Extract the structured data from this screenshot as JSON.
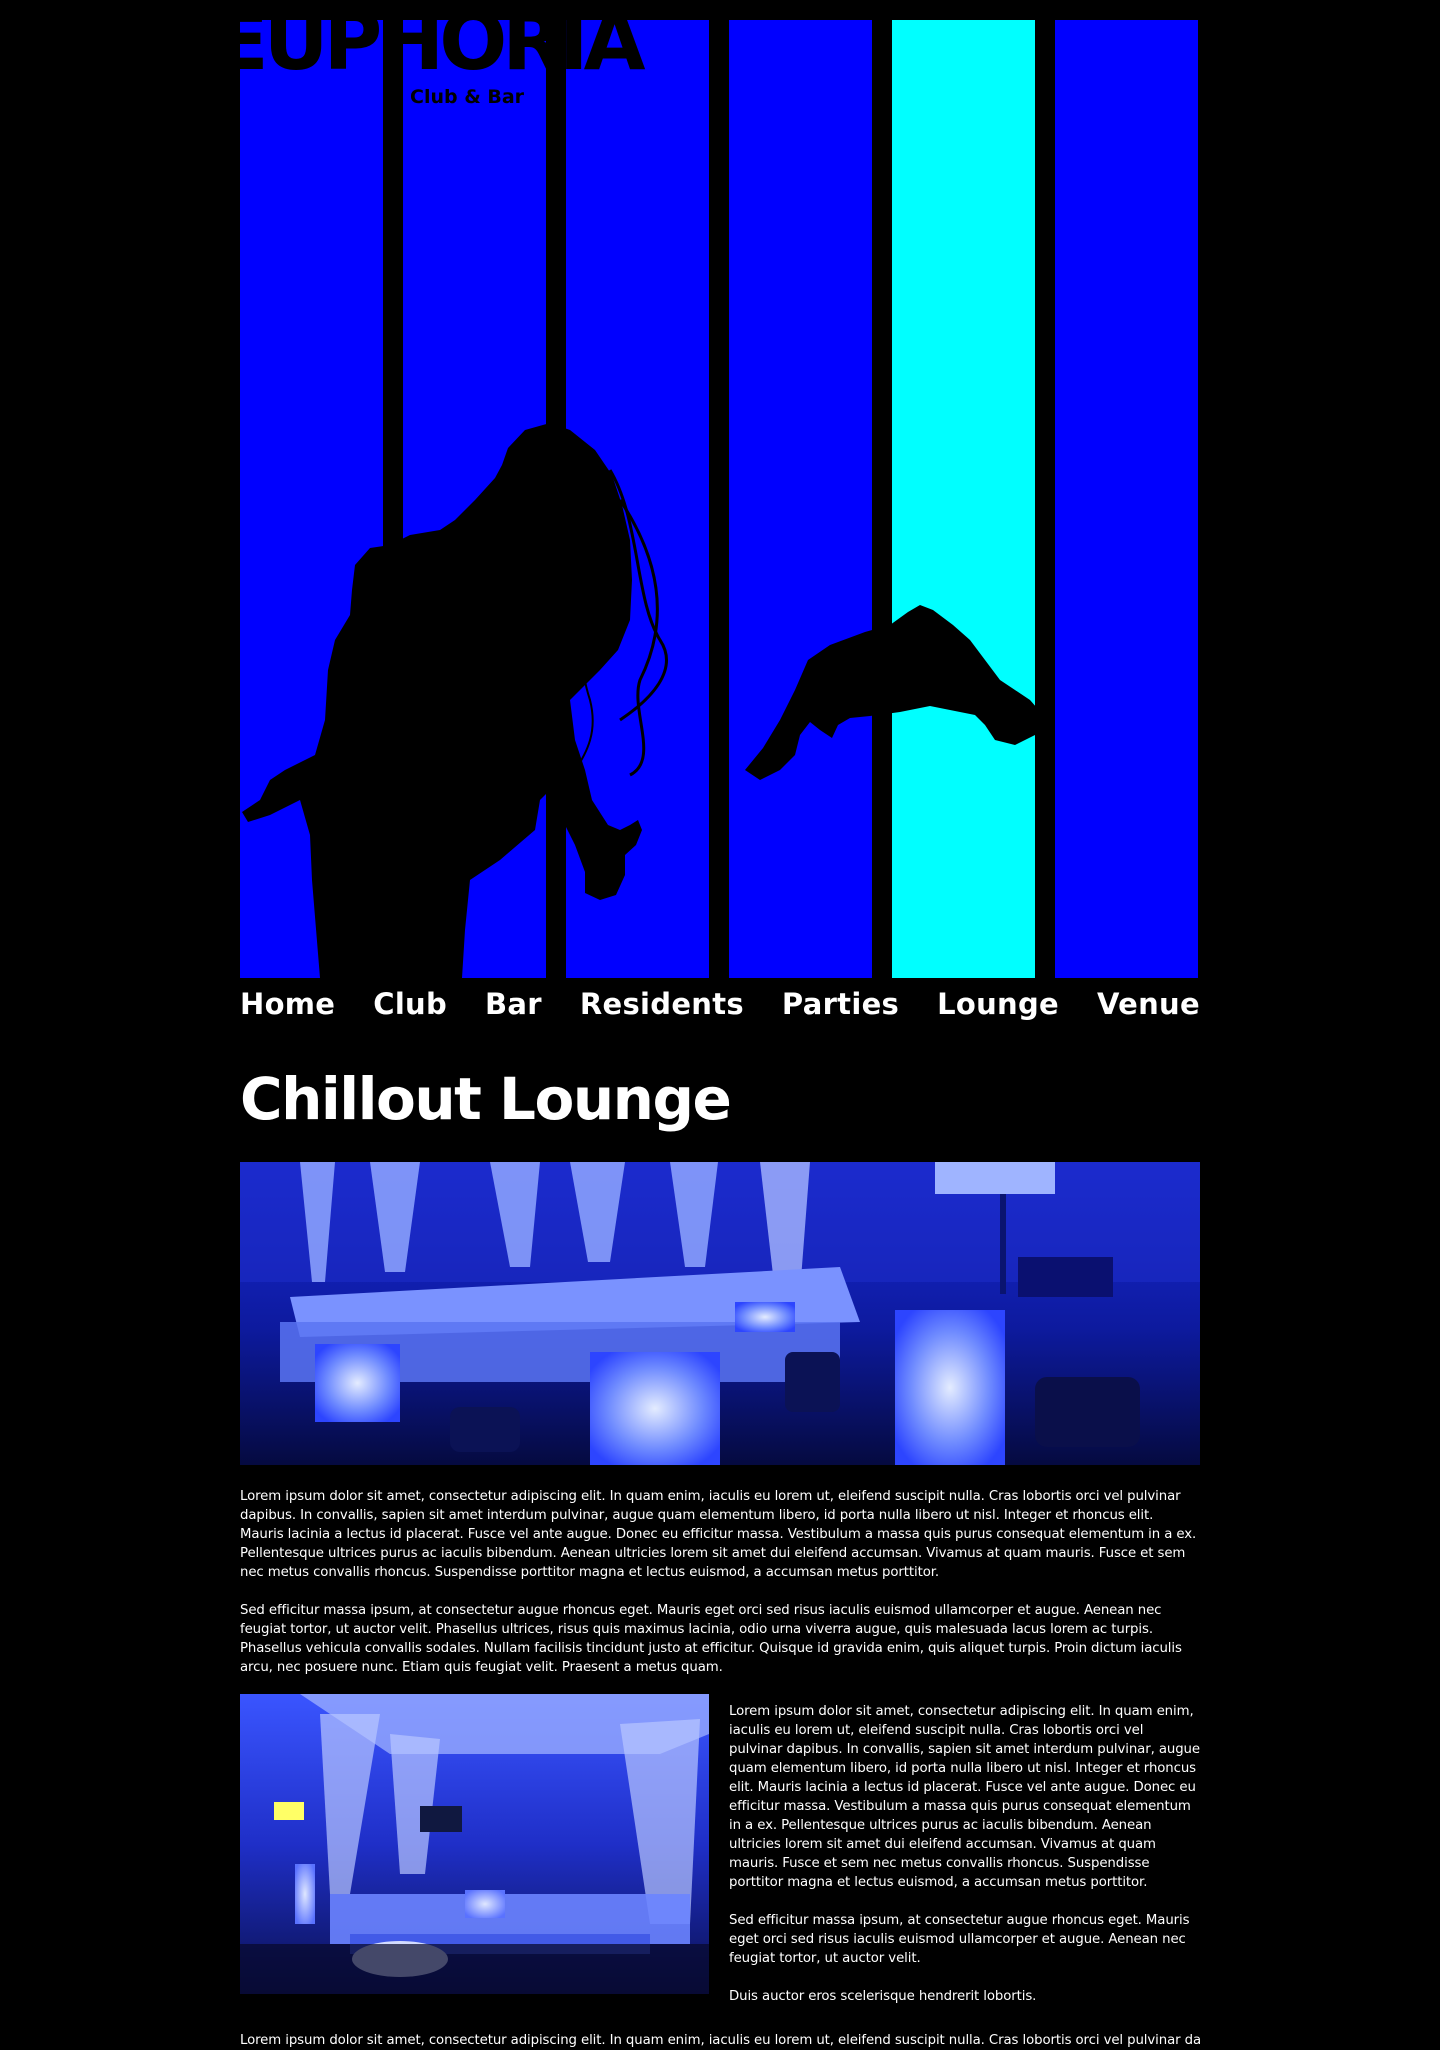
{
  "header": {
    "logo_text": "EUPHORIA",
    "tagline": "Club & Bar",
    "accent_color": "#0000ff",
    "active_bar_color": "#00ffff"
  },
  "nav": {
    "items": [
      {
        "label": "Home"
      },
      {
        "label": "Club"
      },
      {
        "label": "Bar"
      },
      {
        "label": "Residents"
      },
      {
        "label": "Parties"
      },
      {
        "label": "Lounge"
      },
      {
        "label": "Venue"
      }
    ]
  },
  "main": {
    "title": "Chillout Lounge",
    "images": {
      "lounge_photo_icon": "photo-lounge-seating",
      "tent_photo_icon": "photo-tent-lounge"
    },
    "paragraphs": [
      "Lorem ipsum dolor sit amet, consectetur adipiscing elit. In quam enim, iaculis eu lorem ut, eleifend suscipit nulla. Cras lobortis orci vel pulvinar dapibus. In convallis, sapien sit amet interdum pulvinar, augue quam elementum libero, id porta nulla libero ut nisl. Integer et rhoncus elit. Mauris lacinia a lectus id placerat. Fusce vel ante augue. Donec eu efficitur massa. Vestibulum a massa quis purus consequat elementum in a ex. Pellentesque ultrices purus ac iaculis bibendum. Aenean ultricies lorem sit amet dui eleifend accumsan. Vivamus at quam mauris. Fusce et sem nec metus convallis rhoncus. Suspendisse porttitor magna et lectus euismod, a accumsan metus porttitor.",
      "Sed efficitur massa ipsum, at consectetur augue rhoncus eget. Mauris eget orci sed risus iaculis euismod ullamcorper et augue. Aenean nec feugiat tortor, ut auctor velit. Phasellus ultrices, risus quis maximus lacinia, odio urna viverra augue, quis malesuada lacus lorem ac turpis. Phasellus vehicula convallis sodales. Nullam facilisis tincidunt justo at efficitur. Quisque id gravida enim, quis aliquet turpis. Proin dictum iaculis arcu, nec posuere nunc. Etiam quis feugiat velit. Praesent a metus quam."
    ],
    "side_paragraphs": [
      "Lorem ipsum dolor sit amet, consectetur adipiscing elit. In quam enim, iaculis eu lorem ut, eleifend suscipit nulla. Cras lobortis orci vel pulvinar dapibus. In convallis, sapien sit amet interdum pulvinar, augue quam elementum libero, id porta nulla libero ut nisl. Integer et rhoncus elit. Mauris lacinia a lectus id placerat. Fusce vel ante augue. Donec eu efficitur massa. Vestibulum a massa quis purus consequat elementum in a ex. Pellentesque ultrices purus ac iaculis bibendum. Aenean ultricies lorem sit amet dui eleifend accumsan. Vivamus at quam mauris. Fusce et sem nec metus convallis rhoncus. Suspendisse porttitor magna et lectus euismod, a accumsan metus porttitor.",
      "Sed efficitur massa ipsum, at consectetur augue rhoncus eget. Mauris eget orci sed risus iaculis euismod ullamcorper et augue. Aenean nec feugiat tortor, ut auctor velit.",
      "Duis auctor eros scelerisque hendrerit lobortis."
    ],
    "footer_paragraph": "Lorem ipsum dolor sit amet, consectetur adipiscing elit. In quam enim, iaculis eu lorem ut, eleifend suscipit nulla. Cras lobortis orci vel pulvinar dapibus."
  }
}
